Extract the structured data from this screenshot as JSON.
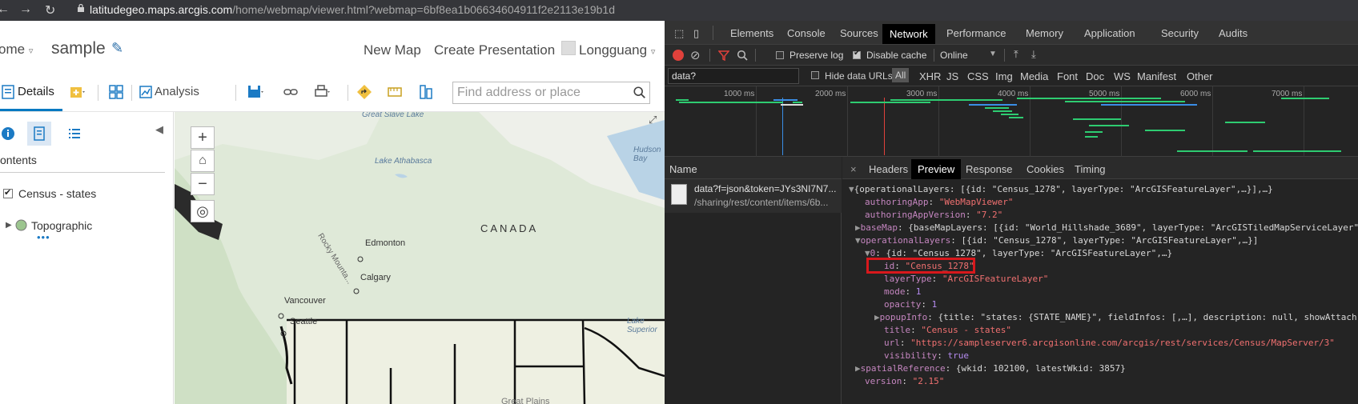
{
  "browser": {
    "host": "latitudegeo.maps.arcgis.com",
    "path": "/home/webmap/viewer.html?webmap=6bf8ea1b06634604911f2e2113e19b1d"
  },
  "arcgis": {
    "header": {
      "home": "ome",
      "title": "sample",
      "new_map": "New Map",
      "create_presentation": "Create Presentation",
      "user": "Longguang"
    },
    "toolbar": {
      "details": "Details",
      "analysis": "Analysis",
      "search_placeholder": "Find address or place"
    },
    "sidebar": {
      "contents_label": "ontents",
      "layers": [
        {
          "label": "Census - states",
          "checked": true
        },
        {
          "label": "Topographic"
        }
      ]
    },
    "map": {
      "labels": {
        "great_slave": "Great Slave Lake",
        "athabasca": "Lake Athabasca",
        "hudson": "Hudson Bay",
        "canada": "CANADA",
        "edmonton": "Edmonton",
        "calgary": "Calgary",
        "vancouver": "Vancouver",
        "seattle": "Seattle",
        "rocky": "Rocky Mounta...",
        "lake_superior": "Lake Superior",
        "great_plains": "Great Plains"
      }
    }
  },
  "devtools": {
    "tabs": [
      "Elements",
      "Console",
      "Sources",
      "Network",
      "Performance",
      "Memory",
      "Application",
      "Security",
      "Audits"
    ],
    "selected_tab": "Network",
    "controls": {
      "preserve_log": "Preserve log",
      "disable_cache": "Disable cache",
      "throttle": "Online"
    },
    "filter": {
      "value": "data?",
      "hide_data_urls": "Hide data URLs",
      "types": [
        "All",
        "XHR",
        "JS",
        "CSS",
        "Img",
        "Media",
        "Font",
        "Doc",
        "WS",
        "Manifest",
        "Other"
      ]
    },
    "timeline_ticks": [
      "1000 ms",
      "2000 ms",
      "3000 ms",
      "4000 ms",
      "5000 ms",
      "6000 ms",
      "7000 ms"
    ],
    "request": {
      "name_header": "Name",
      "line1": "data?f=json&token=JYs3NI7N7...",
      "line2": "/sharing/rest/content/items/6b..."
    },
    "preview_tabs": [
      "Headers",
      "Preview",
      "Response",
      "Cookies",
      "Timing"
    ],
    "preview": {
      "root": "{operationalLayers: [{id: \"Census_1278\", layerType: \"ArcGISFeatureLayer\",…}],…}",
      "authoringApp_key": "authoringApp",
      "authoringApp_val": "\"WebMapViewer\"",
      "authoringAppVersion_key": "authoringAppVersion",
      "authoringAppVersion_val": "\"7.2\"",
      "baseMap_key": "baseMap",
      "baseMap_val": "{baseMapLayers: [{id: \"World_Hillshade_3689\", layerType: \"ArcGISTiledMapServiceLayer\"",
      "opLayers_key": "operationalLayers",
      "opLayers_val": "[{id: \"Census_1278\", layerType: \"ArcGISFeatureLayer\",…}]",
      "item0_key": "0",
      "item0_val": "{id: \"Census_1278\", layerType: \"ArcGISFeatureLayer\",…}",
      "id_key": "id",
      "id_val": "\"Census_1278\"",
      "layerType_key": "layerType",
      "layerType_val": "\"ArcGISFeatureLayer\"",
      "mode_key": "mode",
      "mode_val": "1",
      "opacity_key": "opacity",
      "opacity_val": "1",
      "popupInfo_key": "popupInfo",
      "popupInfo_val": "{title: \"states: {STATE_NAME}\", fieldInfos: [,…], description: null, showAttach",
      "title_key": "title",
      "title_val": "\"Census - states\"",
      "url_key": "url",
      "url_val": "\"https://sampleserver6.arcgisonline.com/arcgis/rest/services/Census/MapServer/3\"",
      "visibility_key": "visibility",
      "visibility_val": "true",
      "spatialReference_key": "spatialReference",
      "spatialReference_val": "{wkid: 102100, latestWkid: 3857}",
      "version_key": "version",
      "version_val": "\"2.15\""
    }
  }
}
